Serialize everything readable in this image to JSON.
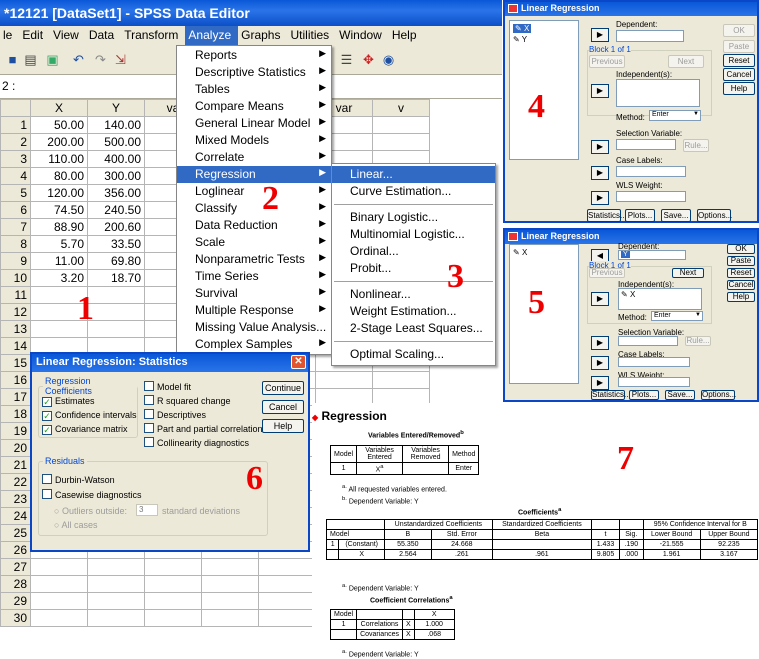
{
  "window": {
    "title": "*12121 [DataSet1] - SPSS Data Editor"
  },
  "menubar": [
    "le",
    "Edit",
    "View",
    "Data",
    "Transform",
    "Analyze",
    "Graphs",
    "Utilities",
    "Window",
    "Help"
  ],
  "cell_ref": "2 :",
  "grid": {
    "columns": [
      "X",
      "Y",
      "va",
      "var",
      "var",
      "var",
      "v"
    ],
    "rows": [
      {
        "n": "1",
        "x": "50.00",
        "y": "140.00"
      },
      {
        "n": "2",
        "x": "200.00",
        "y": "500.00"
      },
      {
        "n": "3",
        "x": "110.00",
        "y": "400.00"
      },
      {
        "n": "4",
        "x": "80.00",
        "y": "300.00"
      },
      {
        "n": "5",
        "x": "120.00",
        "y": "356.00"
      },
      {
        "n": "6",
        "x": "74.50",
        "y": "240.50"
      },
      {
        "n": "7",
        "x": "88.90",
        "y": "200.60"
      },
      {
        "n": "8",
        "x": "5.70",
        "y": "33.50"
      },
      {
        "n": "9",
        "x": "11.00",
        "y": "69.80"
      },
      {
        "n": "10",
        "x": "3.20",
        "y": "18.70"
      },
      {
        "n": "11",
        "x": "",
        "y": ""
      },
      {
        "n": "12",
        "x": "",
        "y": ""
      },
      {
        "n": "13",
        "x": "",
        "y": ""
      },
      {
        "n": "14",
        "x": "",
        "y": ""
      },
      {
        "n": "15",
        "x": "",
        "y": ""
      },
      {
        "n": "16",
        "x": "",
        "y": ""
      },
      {
        "n": "17",
        "x": "",
        "y": ""
      },
      {
        "n": "18",
        "x": "",
        "y": ""
      },
      {
        "n": "19",
        "x": "",
        "y": ""
      },
      {
        "n": "20",
        "x": "",
        "y": ""
      },
      {
        "n": "21",
        "x": "",
        "y": ""
      },
      {
        "n": "22",
        "x": "",
        "y": ""
      },
      {
        "n": "23",
        "x": "",
        "y": ""
      },
      {
        "n": "24",
        "x": "",
        "y": ""
      },
      {
        "n": "25",
        "x": "",
        "y": ""
      },
      {
        "n": "26",
        "x": "",
        "y": ""
      },
      {
        "n": "27",
        "x": "",
        "y": ""
      },
      {
        "n": "28",
        "x": "",
        "y": ""
      },
      {
        "n": "29",
        "x": "",
        "y": ""
      },
      {
        "n": "30",
        "x": "",
        "y": ""
      }
    ]
  },
  "analyze_menu": [
    "Reports",
    "Descriptive Statistics",
    "Tables",
    "Compare Means",
    "General Linear Model",
    "Mixed Models",
    "Correlate",
    "Regression",
    "Loglinear",
    "Classify",
    "Data Reduction",
    "Scale",
    "Nonparametric Tests",
    "Time Series",
    "Survival",
    "Multiple Response",
    "Missing Value Analysis...",
    "Complex Samples"
  ],
  "regression_menu": [
    "Linear...",
    "Curve Estimation...",
    "Binary Logistic...",
    "Multinomial Logistic...",
    "Ordinal...",
    "Probit...",
    "Nonlinear...",
    "Weight Estimation...",
    "2-Stage Least Squares...",
    "Optimal Scaling..."
  ],
  "step_labels": [
    "1",
    "2",
    "3",
    "4",
    "5",
    "6",
    "7"
  ],
  "linreg": {
    "title": "Linear Regression",
    "vars": [
      "X",
      "Y"
    ],
    "dependent": "Dependent:",
    "dependent_value": "Y",
    "block": "Block 1 of 1",
    "previous": "Previous",
    "next": "Next",
    "independent": "Independent(s):",
    "independent_value": "X",
    "method": "Method:",
    "method_value": "Enter",
    "selection": "Selection Variable:",
    "rule": "Rule...",
    "case_labels": "Case Labels:",
    "wls": "WLS Weight:",
    "buttons": [
      "OK",
      "Paste",
      "Reset",
      "Cancel",
      "Help"
    ],
    "bottom_buttons": [
      "Statistics...",
      "Plots...",
      "Save...",
      "Options..."
    ]
  },
  "stats": {
    "title": "Linear Regression: Statistics",
    "coef_group": "Regression Coefficients",
    "estimates": "Estimates",
    "conf": "Confidence intervals",
    "cov": "Covariance matrix",
    "model_fit": "Model fit",
    "rsq": "R squared change",
    "desc": "Descriptives",
    "partial": "Part and partial correlations",
    "collin": "Collinearity diagnostics",
    "residuals": "Residuals",
    "dw": "Durbin-Watson",
    "casewise": "Casewise diagnostics",
    "outliers": "Outliers outside:",
    "outliers_value": "3",
    "sd": "standard deviations",
    "allcases": "All cases",
    "continue": "Continue",
    "cancel": "Cancel",
    "help": "Help"
  },
  "output": {
    "heading": "Regression",
    "t1_title": "Variables Entered/Removed",
    "t1_sup": "b",
    "t1_head": [
      "Model",
      "Variables Entered",
      "Variables Removed",
      "Method"
    ],
    "t1_row": [
      "1",
      "X",
      "",
      "Enter"
    ],
    "t1_row_sup": "a",
    "t1_note_a": "All requested variables entered.",
    "t1_note_b": "Dependent Variable: Y",
    "t2_title": "Coefficients",
    "t2_sup": "a",
    "t2_h1": [
      "Unstandardized Coefficients",
      "Standardized Coefficients",
      "95% Confidence Interval for B"
    ],
    "t2_h2": [
      "Model",
      "B",
      "Std. Error",
      "Beta",
      "t",
      "Sig.",
      "Lower Bound",
      "Upper Bound"
    ],
    "t2_rows": [
      [
        "1",
        "(Constant)",
        "55.350",
        "24.668",
        "",
        "1.433",
        ".190",
        "-21.555",
        "92.235"
      ],
      [
        "",
        "X",
        "2.564",
        ".261",
        ".961",
        "9.805",
        ".000",
        "1.961",
        "3.167"
      ]
    ],
    "t2_note": "Dependent Variable: Y",
    "t3_title": "Coefficient Correlations",
    "t3_sup": "a",
    "t3_head": [
      "Model",
      "",
      "",
      "X"
    ],
    "t3_rows": [
      [
        "1",
        "Correlations",
        "X",
        "1.000"
      ],
      [
        "",
        "Covariances",
        "X",
        ".068"
      ]
    ],
    "t3_note": "Dependent Variable: Y"
  }
}
